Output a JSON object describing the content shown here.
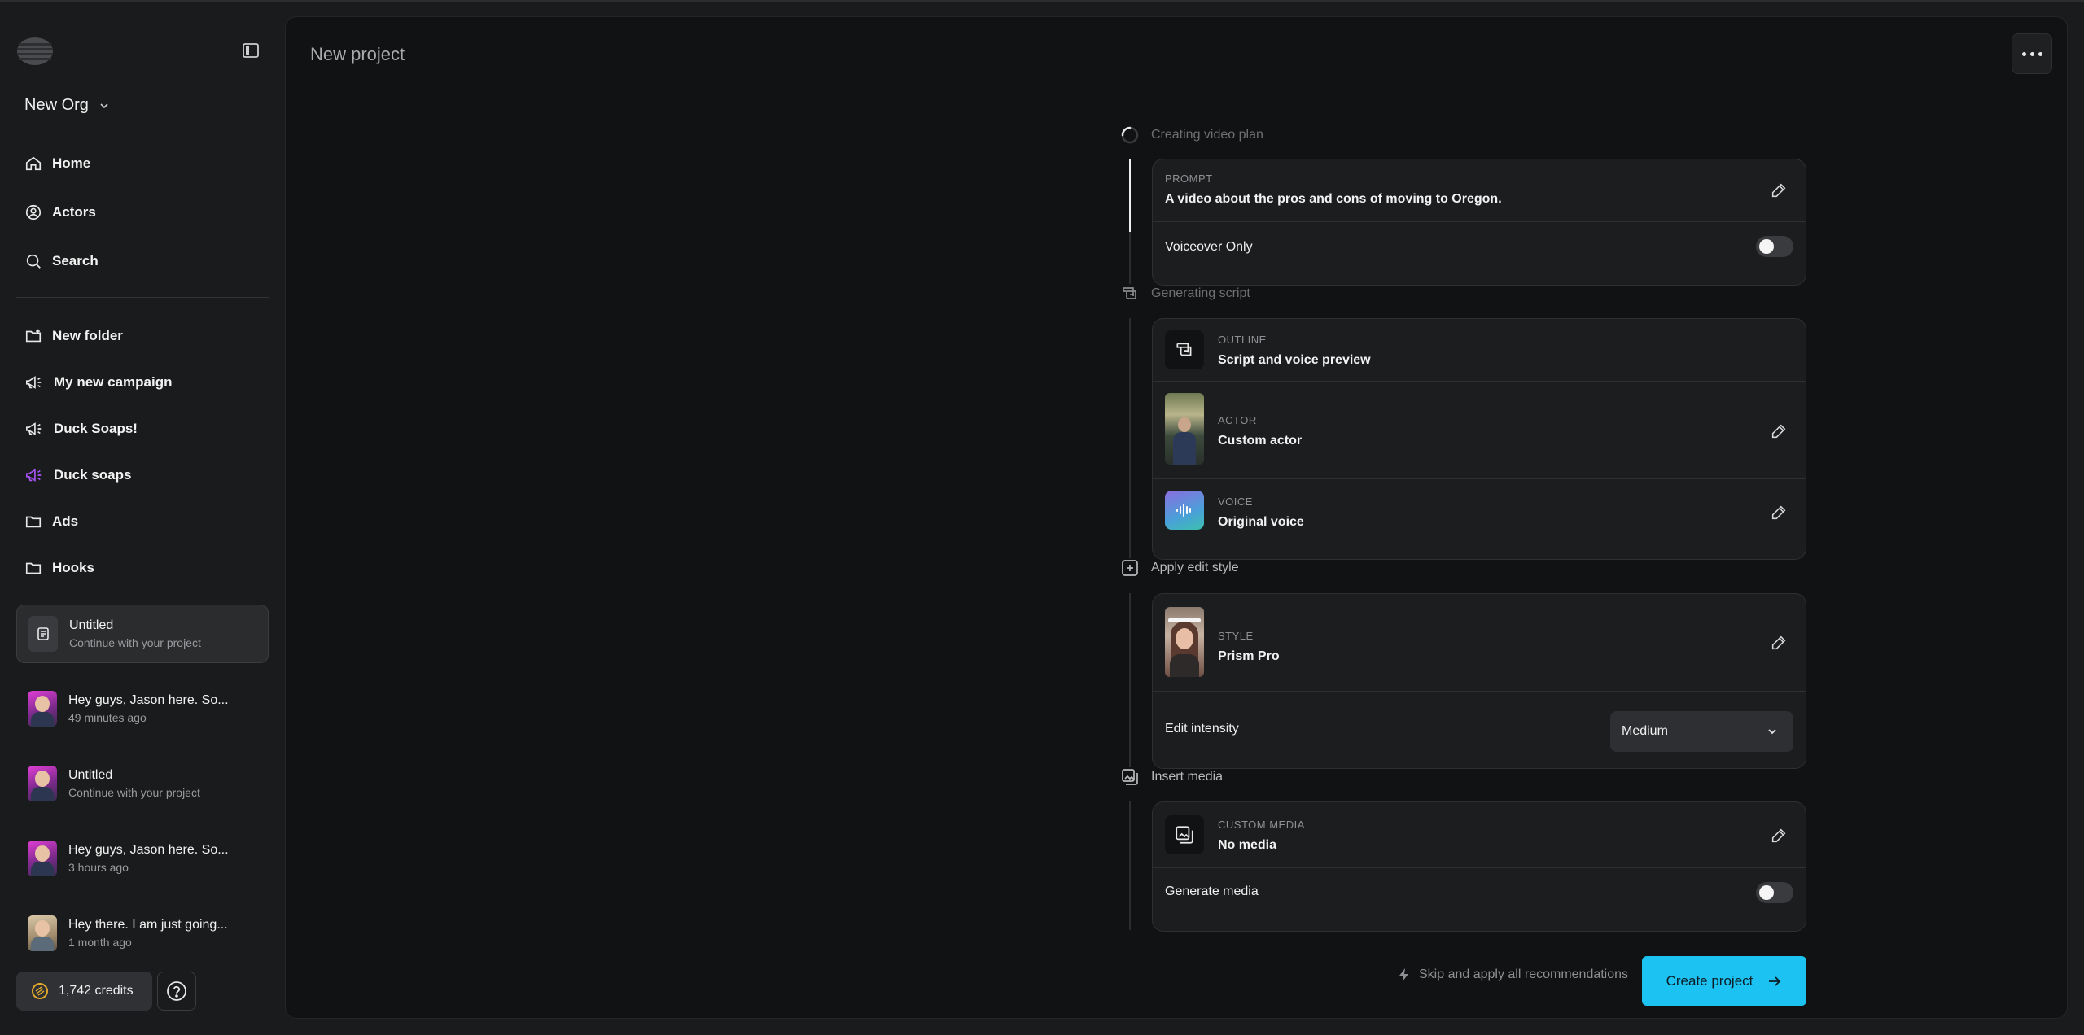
{
  "app": {
    "page_title": "New project"
  },
  "sidebar": {
    "org_name": "New Org",
    "nav": [
      {
        "label": "Home",
        "icon": "home-icon"
      },
      {
        "label": "Actors",
        "icon": "user-circle-icon"
      },
      {
        "label": "Search",
        "icon": "search-icon"
      }
    ],
    "folders": [
      {
        "label": "New folder",
        "icon": "folder-plus-icon"
      },
      {
        "label": "My new campaign",
        "icon": "megaphone-icon"
      },
      {
        "label": "Duck Soaps!",
        "icon": "megaphone-icon"
      },
      {
        "label": "Duck soaps",
        "icon": "megaphone-icon",
        "color": "#a855f7"
      },
      {
        "label": "Ads",
        "icon": "folder-icon"
      },
      {
        "label": "Hooks",
        "icon": "folder-icon"
      }
    ],
    "projects": [
      {
        "title": "Untitled",
        "subtitle": "Continue with your project",
        "active": true
      },
      {
        "title": "Hey guys, Jason here. So...",
        "subtitle": "49 minutes ago"
      },
      {
        "title": "Untitled",
        "subtitle": "Continue with your project"
      },
      {
        "title": "Hey guys, Jason here. So...",
        "subtitle": "3 hours ago"
      },
      {
        "title": "Hey there. I am just going...",
        "subtitle": "1 month ago"
      }
    ],
    "credits": "1,742 credits"
  },
  "steps": {
    "plan": {
      "label": "Creating video plan",
      "prompt_caption": "PROMPT",
      "prompt_text": "A video about the pros and cons of moving to Oregon.",
      "voiceover_label": "Voiceover Only",
      "voiceover_on": false
    },
    "script": {
      "label": "Generating script",
      "outline_caption": "OUTLINE",
      "outline_value": "Script and voice preview",
      "actor_caption": "ACTOR",
      "actor_value": "Custom actor",
      "voice_caption": "VOICE",
      "voice_value": "Original voice"
    },
    "style": {
      "label": "Apply edit style",
      "style_caption": "STYLE",
      "style_value": "Prism Pro",
      "intensity_label": "Edit intensity",
      "intensity_value": "Medium"
    },
    "media": {
      "label": "Insert media",
      "media_caption": "CUSTOM MEDIA",
      "media_value": "No media",
      "generate_label": "Generate media",
      "generate_on": false
    }
  },
  "footer": {
    "skip_label": "Skip and apply all recommendations",
    "create_label": "Create project"
  },
  "colors": {
    "accent": "#1cc2f2",
    "panel": "#111213",
    "card": "#1c1d1f"
  }
}
